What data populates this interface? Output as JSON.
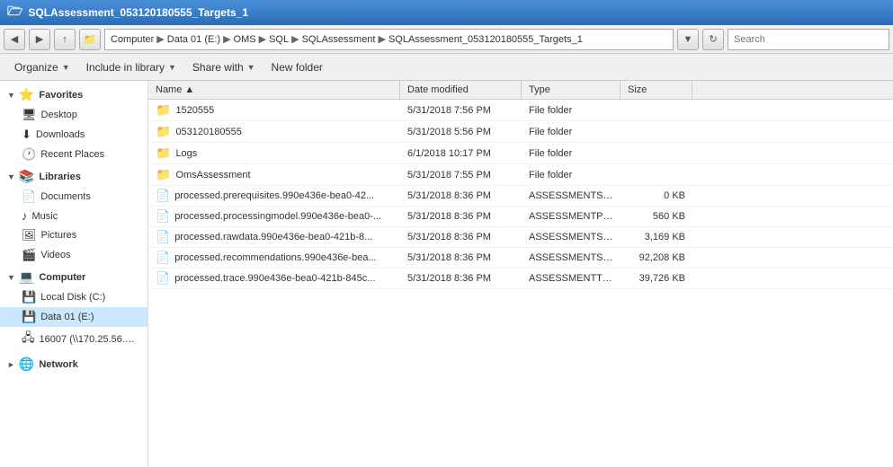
{
  "titleBar": {
    "title": "SQLAssessment_053120180555_Targets_1",
    "icon": "🗁"
  },
  "addressBar": {
    "path": [
      {
        "label": "Computer"
      },
      {
        "label": "Data 01 (E:)"
      },
      {
        "label": "OMS"
      },
      {
        "label": "SQL"
      },
      {
        "label": "SQLAssessment"
      },
      {
        "label": "SQLAssessment_053120180555_Targets_1"
      }
    ],
    "search_placeholder": "Search"
  },
  "actions": [
    {
      "label": "Organize",
      "has_arrow": true,
      "name": "organize-btn"
    },
    {
      "label": "Include in library",
      "has_arrow": true,
      "name": "include-library-btn"
    },
    {
      "label": "Share with",
      "has_arrow": true,
      "name": "share-with-btn"
    },
    {
      "label": "New folder",
      "has_arrow": false,
      "name": "new-folder-btn"
    }
  ],
  "sidebar": {
    "sections": [
      {
        "name": "Favorites",
        "icon": "⭐",
        "items": [
          {
            "label": "Desktop",
            "icon": "🖥",
            "name": "sidebar-item-desktop"
          },
          {
            "label": "Downloads",
            "icon": "⬇",
            "name": "sidebar-item-downloads"
          },
          {
            "label": "Recent Places",
            "icon": "🕐",
            "name": "sidebar-item-recent-places"
          }
        ]
      },
      {
        "name": "Libraries",
        "icon": "📚",
        "items": [
          {
            "label": "Documents",
            "icon": "📄",
            "name": "sidebar-item-documents"
          },
          {
            "label": "Music",
            "icon": "♪",
            "name": "sidebar-item-music"
          },
          {
            "label": "Pictures",
            "icon": "🖼",
            "name": "sidebar-item-pictures"
          },
          {
            "label": "Videos",
            "icon": "🎬",
            "name": "sidebar-item-videos"
          }
        ]
      },
      {
        "name": "Computer",
        "icon": "💻",
        "items": [
          {
            "label": "Local Disk (C:)",
            "icon": "💾",
            "name": "sidebar-item-c-drive"
          },
          {
            "label": "Data 01 (E:)",
            "icon": "💾",
            "name": "sidebar-item-e-drive",
            "selected": true
          },
          {
            "label": "16007 (\\\\170.25.56.2...",
            "icon": "🖧",
            "name": "sidebar-item-network-drive"
          }
        ]
      },
      {
        "name": "Network",
        "icon": "🌐",
        "items": []
      }
    ]
  },
  "columns": [
    {
      "label": "Name",
      "sort": "asc",
      "name": "col-name"
    },
    {
      "label": "Date modified",
      "name": "col-date"
    },
    {
      "label": "Type",
      "name": "col-type"
    },
    {
      "label": "Size",
      "name": "col-size"
    }
  ],
  "files": [
    {
      "name": "1520555",
      "date": "5/31/2018 7:56 PM",
      "type": "File folder",
      "size": "",
      "is_folder": true
    },
    {
      "name": "053120180555",
      "date": "5/31/2018 5:56 PM",
      "type": "File folder",
      "size": "",
      "is_folder": true
    },
    {
      "name": "Logs",
      "date": "6/1/2018 10:17 PM",
      "type": "File folder",
      "size": "",
      "is_folder": true
    },
    {
      "name": "OmsAssessment",
      "date": "5/31/2018 7:55 PM",
      "type": "File folder",
      "size": "",
      "is_folder": true
    },
    {
      "name": "processed.prerequisites.990e436e-bea0-42...",
      "date": "5/31/2018 8:36 PM",
      "type": "ASSESSMENTSQLRE...",
      "size": "0 KB",
      "is_folder": false
    },
    {
      "name": "processed.processingmodel.990e436e-bea0-...",
      "date": "5/31/2018 8:36 PM",
      "type": "ASSESSMENTPM File",
      "size": "560 KB",
      "is_folder": false
    },
    {
      "name": "processed.rawdata.990e436e-bea0-421b-8...",
      "date": "5/31/2018 8:36 PM",
      "type": "ASSESSMENTSQLR...",
      "size": "3,169 KB",
      "is_folder": false
    },
    {
      "name": "processed.recommendations.990e436e-bea...",
      "date": "5/31/2018 8:36 PM",
      "type": "ASSESSMENTSQLRE...",
      "size": "92,208 KB",
      "is_folder": false
    },
    {
      "name": "processed.trace.990e436e-bea0-421b-845c...",
      "date": "5/31/2018 8:36 PM",
      "type": "ASSESSMENTTRAC...",
      "size": "39,726 KB",
      "is_folder": false
    }
  ]
}
